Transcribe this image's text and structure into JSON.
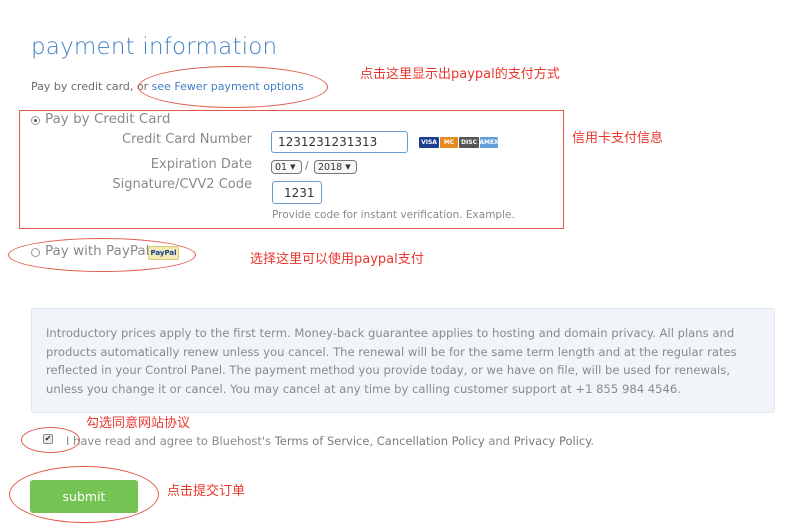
{
  "header": {
    "title": "payment information",
    "subline_prefix": "Pay by credit card, or ",
    "subline_link": "see Fewer payment options"
  },
  "annotations": {
    "show_paypal": "点击这里显示出paypal的支付方式",
    "card_info": "信用卡支付信息",
    "select_paypal": "选择这里可以使用paypal支付",
    "agree_terms": "勾选同意网站协议",
    "submit": "点击提交订单"
  },
  "credit_card": {
    "option_label": "Pay by Credit Card",
    "number_label": "Credit Card Number",
    "number_value": "1231231231313",
    "expiration_label": "Expiration Date",
    "exp_month": "01",
    "exp_separator": "/",
    "exp_year": "2018",
    "cvv_label": "Signature/CVV2 Code",
    "cvv_value": "1231",
    "hint": "Provide code for instant verification. Example.",
    "logos": [
      {
        "name": "visa",
        "text": "VISA",
        "color": "#1a3f8f"
      },
      {
        "name": "mastercard",
        "text": "MC",
        "color": "#e58a1f"
      },
      {
        "name": "discover",
        "text": "DISC",
        "color": "#555555"
      },
      {
        "name": "amex",
        "text": "AMEX",
        "color": "#5d9fd6"
      }
    ]
  },
  "paypal": {
    "option_label": "Pay with PayPal",
    "badge": "PayPal"
  },
  "notice": {
    "text": "Introductory prices apply to the first term. Money-back guarantee applies to hosting and domain privacy. All plans and products automatically renew unless you cancel. The renewal will be for the same term length and at the regular rates reflected in your Control Panel. The payment method you provide today, or we have on file, will be used for renewals, unless you change it or cancel. You may cancel at any time by calling customer support at +1 855 984 4546."
  },
  "agreement": {
    "prefix": "I have read and agree to Bluehost's ",
    "terms": "Terms of Service",
    "sep1": ", ",
    "cancellation": "Cancellation Policy",
    "sep2": " and ",
    "privacy": "Privacy Policy",
    "suffix": ".",
    "checkmark": "✔"
  },
  "submit": {
    "label": "submit"
  },
  "colors": {
    "accent": "#3f7fc4",
    "annotation": "#e8362c",
    "submit": "#74c353"
  }
}
